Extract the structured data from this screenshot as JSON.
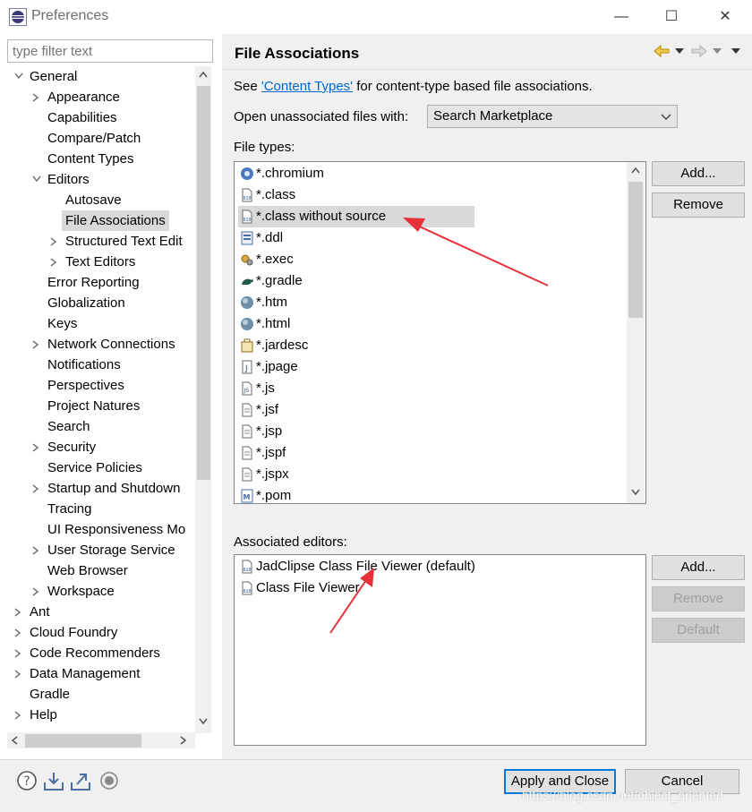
{
  "window": {
    "title": "Preferences",
    "minimize_glyph": "—",
    "maximize_glyph": "☐",
    "close_glyph": "✕"
  },
  "filter": {
    "placeholder": "type filter text"
  },
  "tree": {
    "items": [
      {
        "label": "General",
        "expanded": true,
        "depth": 0
      },
      {
        "label": "Appearance",
        "depth": 1,
        "arrow": true
      },
      {
        "label": "Capabilities",
        "depth": 1
      },
      {
        "label": "Compare/Patch",
        "depth": 1
      },
      {
        "label": "Content Types",
        "depth": 1
      },
      {
        "label": "Editors",
        "depth": 1,
        "expanded": true
      },
      {
        "label": "Autosave",
        "depth": 2
      },
      {
        "label": "File Associations",
        "depth": 2,
        "selected": true
      },
      {
        "label": "Structured Text Edit",
        "depth": 2,
        "arrow": true
      },
      {
        "label": "Text Editors",
        "depth": 2,
        "arrow": true
      },
      {
        "label": "Error Reporting",
        "depth": 1
      },
      {
        "label": "Globalization",
        "depth": 1
      },
      {
        "label": "Keys",
        "depth": 1
      },
      {
        "label": "Network Connections",
        "depth": 1,
        "arrow": true
      },
      {
        "label": "Notifications",
        "depth": 1
      },
      {
        "label": "Perspectives",
        "depth": 1
      },
      {
        "label": "Project Natures",
        "depth": 1
      },
      {
        "label": "Search",
        "depth": 1
      },
      {
        "label": "Security",
        "depth": 1,
        "arrow": true
      },
      {
        "label": "Service Policies",
        "depth": 1
      },
      {
        "label": "Startup and Shutdown",
        "depth": 1,
        "arrow": true
      },
      {
        "label": "Tracing",
        "depth": 1
      },
      {
        "label": "UI Responsiveness Mo",
        "depth": 1
      },
      {
        "label": "User Storage Service",
        "depth": 1,
        "arrow": true
      },
      {
        "label": "Web Browser",
        "depth": 1
      },
      {
        "label": "Workspace",
        "depth": 1,
        "arrow": true
      },
      {
        "label": "Ant",
        "depth": 0,
        "arrow": true
      },
      {
        "label": "Cloud Foundry",
        "depth": 0,
        "arrow": true
      },
      {
        "label": "Code Recommenders",
        "depth": 0,
        "arrow": true
      },
      {
        "label": "Data Management",
        "depth": 0,
        "arrow": true
      },
      {
        "label": "Gradle",
        "depth": 0
      },
      {
        "label": "Help",
        "depth": 0,
        "arrow": true
      }
    ]
  },
  "page": {
    "title": "File Associations",
    "see_prefix": "See ",
    "see_link": "'Content Types'",
    "see_suffix": " for content-type based file associations.",
    "open_label": "Open unassociated files with:",
    "open_value": "Search Marketplace",
    "file_types_label": "File types:",
    "file_types": [
      {
        "label": "*.chromium",
        "icon": "chromium-icon"
      },
      {
        "label": "*.class",
        "icon": "class-file-icon"
      },
      {
        "label": "*.class without source",
        "icon": "class-file-icon",
        "selected": true
      },
      {
        "label": "*.ddl",
        "icon": "ddl-icon"
      },
      {
        "label": "*.exec",
        "icon": "exec-icon"
      },
      {
        "label": "*.gradle",
        "icon": "gradle-icon"
      },
      {
        "label": "*.htm",
        "icon": "web-globe-icon"
      },
      {
        "label": "*.html",
        "icon": "web-globe-icon"
      },
      {
        "label": "*.jardesc",
        "icon": "jardesc-icon"
      },
      {
        "label": "*.jpage",
        "icon": "jpage-icon"
      },
      {
        "label": "*.js",
        "icon": "js-file-icon"
      },
      {
        "label": "*.jsf",
        "icon": "text-file-icon"
      },
      {
        "label": "*.jsp",
        "icon": "text-file-icon"
      },
      {
        "label": "*.jspf",
        "icon": "text-file-icon"
      },
      {
        "label": "*.jspx",
        "icon": "text-file-icon"
      },
      {
        "label": "*.pom",
        "icon": "maven-pom-icon"
      }
    ],
    "add_label": "Add...",
    "remove_label": "Remove",
    "editors_label": "Associated editors:",
    "editors": [
      {
        "label": "JadClipse Class File Viewer (default)",
        "icon": "class-file-icon"
      },
      {
        "label": "Class File Viewer",
        "icon": "class-file-icon"
      }
    ],
    "editor_add_label": "Add...",
    "editor_remove_label": "Remove",
    "editor_default_label": "Default"
  },
  "footer": {
    "apply_close_label": "Apply and Close",
    "cancel_label": "Cancel",
    "watermark": "https://blog.csdn.net/object_oriented"
  },
  "colors": {
    "annotation_arrow": "#e8323a",
    "link": "#0066cc",
    "selection": "#d9d9d9"
  }
}
